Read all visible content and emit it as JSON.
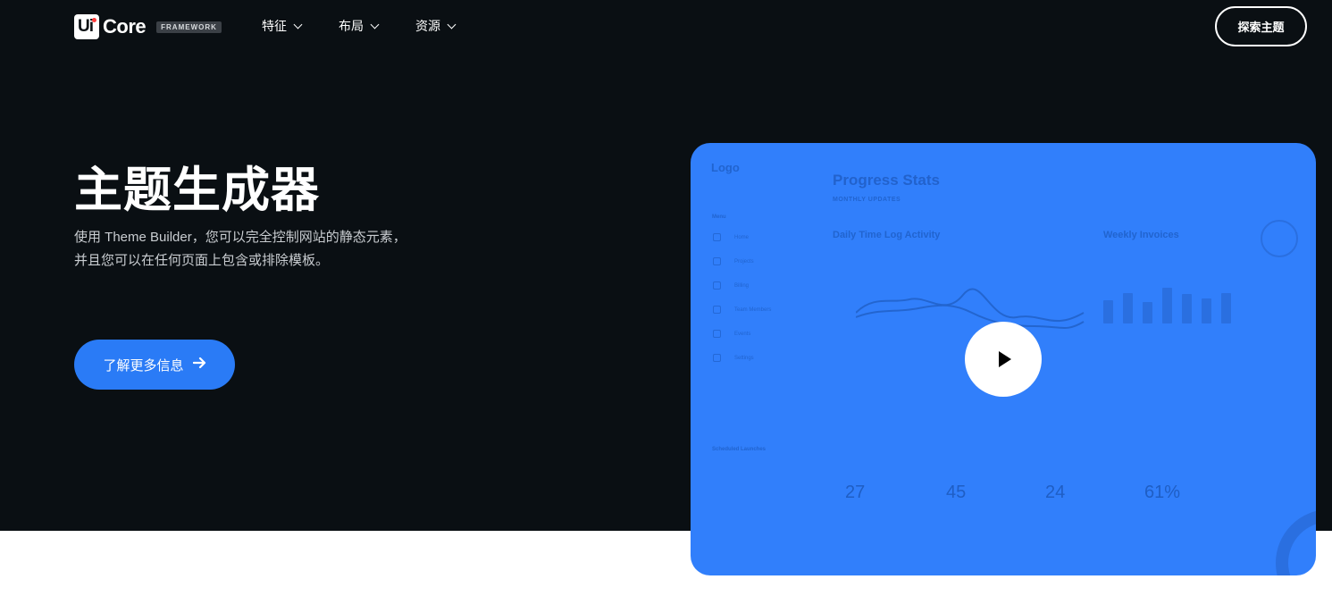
{
  "nav": {
    "logo_mark": "Ui",
    "logo_text": "Core",
    "logo_badge": "FRAMEWORK",
    "menu": [
      {
        "label": "特征"
      },
      {
        "label": "布局"
      },
      {
        "label": "资源"
      }
    ],
    "explore_label": "探索主题"
  },
  "hero": {
    "title": "主题生成器",
    "subtitle_line1": "使用 Theme Builder，您可以完全控制网站的静态元素，",
    "subtitle_line2": "并且您可以在任何页面上包含或排除模板。",
    "cta_label": "了解更多信息",
    "cta_icon": "arrow-right-icon"
  },
  "media": {
    "play_icon": "play-icon",
    "preview": {
      "logo": "Logo",
      "title": "Progress Stats",
      "subtitle": "MONTHLY UPDATES",
      "menu_heading": "Menu",
      "section_activity": "Daily Time Log Activity",
      "section_invoices": "Weekly Invoices",
      "side_items": [
        "Home",
        "Projects",
        "Billing",
        "Team Members",
        "Events",
        "Settings"
      ],
      "launches_heading": "Scheduled Launches",
      "stats": [
        "27",
        "45",
        "24",
        "61%"
      ]
    },
    "accent": "#317ffb"
  },
  "colors": {
    "hero_bg": "#0a0f13",
    "cta_bg": "#2a7bf6"
  }
}
